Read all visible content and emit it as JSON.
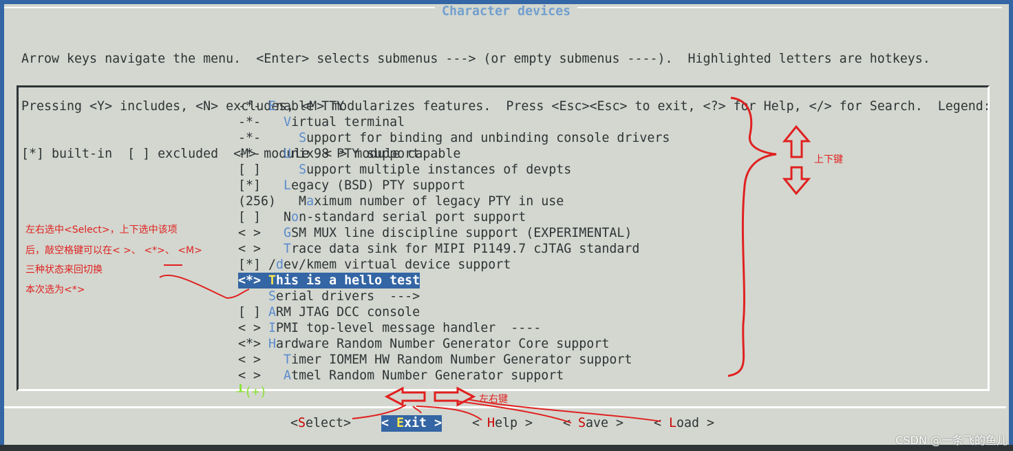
{
  "title": "Character devices",
  "help_lines": [
    "Arrow keys navigate the menu.  <Enter> selects submenus ---> (or empty submenus ----).  Highlighted letters are hotkeys.",
    "Pressing <Y> includes, <N> excludes, <M> modularizes features.  Press <Esc><Esc> to exit, <?> for Help, </> for Search.  Legend:",
    "[*] built-in  [ ] excluded  <M> module  < > module capable"
  ],
  "items": [
    {
      "prefix": "-*- ",
      "hotkey": "E",
      "rest": "nable TTY"
    },
    {
      "prefix": "-*-   ",
      "hotkey": "V",
      "rest": "irtual terminal"
    },
    {
      "prefix": "-*-     ",
      "hotkey": "S",
      "rest": "upport for binding and unbinding console drivers"
    },
    {
      "prefix": "-*-   ",
      "hotkey": "U",
      "rest": "nix98 PTY support"
    },
    {
      "prefix": "[ ]     ",
      "hotkey": "S",
      "rest": "upport multiple instances of devpts"
    },
    {
      "prefix": "[*]   ",
      "hotkey": "L",
      "rest": "egacy (BSD) PTY support"
    },
    {
      "prefix": "(256)   M",
      "hotkey": "a",
      "rest": "ximum number of legacy PTY in use"
    },
    {
      "prefix": "[ ]   N",
      "hotkey": "o",
      "rest": "n-standard serial port support"
    },
    {
      "prefix": "< >   ",
      "hotkey": "G",
      "rest": "SM MUX line discipline support (EXPERIMENTAL)"
    },
    {
      "prefix": "< >   ",
      "hotkey": "T",
      "rest": "race data sink for MIPI P1149.7 cJTAG standard"
    },
    {
      "prefix": "[*] /",
      "hotkey": "d",
      "rest": "ev/kmem virtual device support"
    },
    {
      "prefix": "<*> ",
      "hotkey": "T",
      "rest": "his is a hello test",
      "selected": true
    },
    {
      "prefix": "    ",
      "hotkey": "S",
      "rest": "erial drivers  --->"
    },
    {
      "prefix": "[ ] ",
      "hotkey": "A",
      "rest": "RM JTAG DCC console"
    },
    {
      "prefix": "< > ",
      "hotkey": "I",
      "rest": "PMI top-level message handler  ----"
    },
    {
      "prefix": "<*> ",
      "hotkey": "H",
      "rest": "ardware Random Number Generator Core support"
    },
    {
      "prefix": "< >   ",
      "hotkey": "T",
      "rest": "imer IOMEM HW Random Number Generator support"
    },
    {
      "prefix": "< >   ",
      "hotkey": "A",
      "rest": "tmel Random Number Generator support"
    }
  ],
  "more_indicator": "┸(+)",
  "buttons": [
    {
      "pre": "<",
      "hotkey": "S",
      "post": "elect>"
    },
    {
      "pre": "< ",
      "hotkey": "E",
      "post": "xit >",
      "active": true
    },
    {
      "pre": "< ",
      "hotkey": "H",
      "post": "elp >"
    },
    {
      "pre": "< ",
      "hotkey": "S",
      "post": "ave >"
    },
    {
      "pre": "< ",
      "hotkey": "L",
      "post": "oad >"
    }
  ],
  "annotations": {
    "up_down": "上下键",
    "left_right": "左右键",
    "note_lines": [
      "左右选中<Select>，上下选中该项",
      "后，敲空格键可以在< >、 <*>、 <M>",
      "三种状态来回切换",
      "本次选为<*>"
    ]
  },
  "watermark": "CSDN @一条飞的鱼儿",
  "colors": {
    "accent": "#3465a4",
    "background": "#d3d7cf",
    "hotkey": "#5b8bcf",
    "selected_hotkey": "#fce94f",
    "button_hotkey": "#cc0000",
    "annotation": "#e02020"
  }
}
